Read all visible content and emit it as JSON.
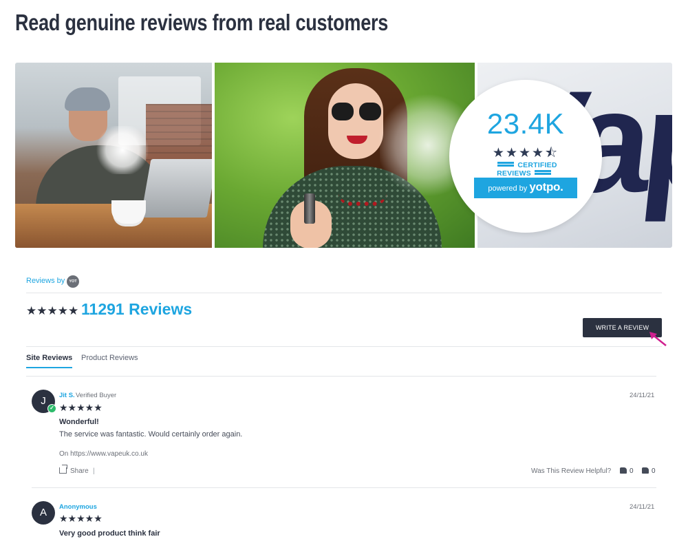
{
  "page": {
    "title": "Read genuine reviews from real customers"
  },
  "hero": {
    "badge": {
      "count": "23.4K",
      "stars": "★★★★⯪",
      "certified_label": "CERTIFIED REVIEWS",
      "powered_prefix": "powered by",
      "brand": "yotpo."
    },
    "brand_letters": "Vap"
  },
  "widget": {
    "reviews_by_label": "Reviews by",
    "yotpo_mini_label": "YOT PO.",
    "summary_stars": "★★★★★",
    "total_reviews": "11291 Reviews",
    "write_review_label": "WRITE A REVIEW",
    "tabs": [
      {
        "label": "Site Reviews",
        "active": true
      },
      {
        "label": "Product Reviews",
        "active": false
      }
    ]
  },
  "reviews": [
    {
      "initial": "J",
      "name": "Jit S.",
      "verified_label": "Verified Buyer",
      "date": "24/11/21",
      "stars": "★★★★★",
      "title": "Wonderful!",
      "body": "The service was fantastic. Would certainly order again.",
      "source": "On https://www.vapeuk.co.uk",
      "share_label": "Share",
      "separator": "|",
      "helpful_label": "Was This Review Helpful?",
      "thumbs_up": "0",
      "thumbs_down": "0"
    },
    {
      "initial": "A",
      "name": "Anonymous",
      "date": "24/11/21",
      "stars": "★★★★★",
      "title": "Very good product think fair"
    }
  ],
  "colors": {
    "accent": "#1ea5e0",
    "dark": "#2b3140",
    "verified": "#2dbb6b",
    "cursor": "#d0208f"
  }
}
